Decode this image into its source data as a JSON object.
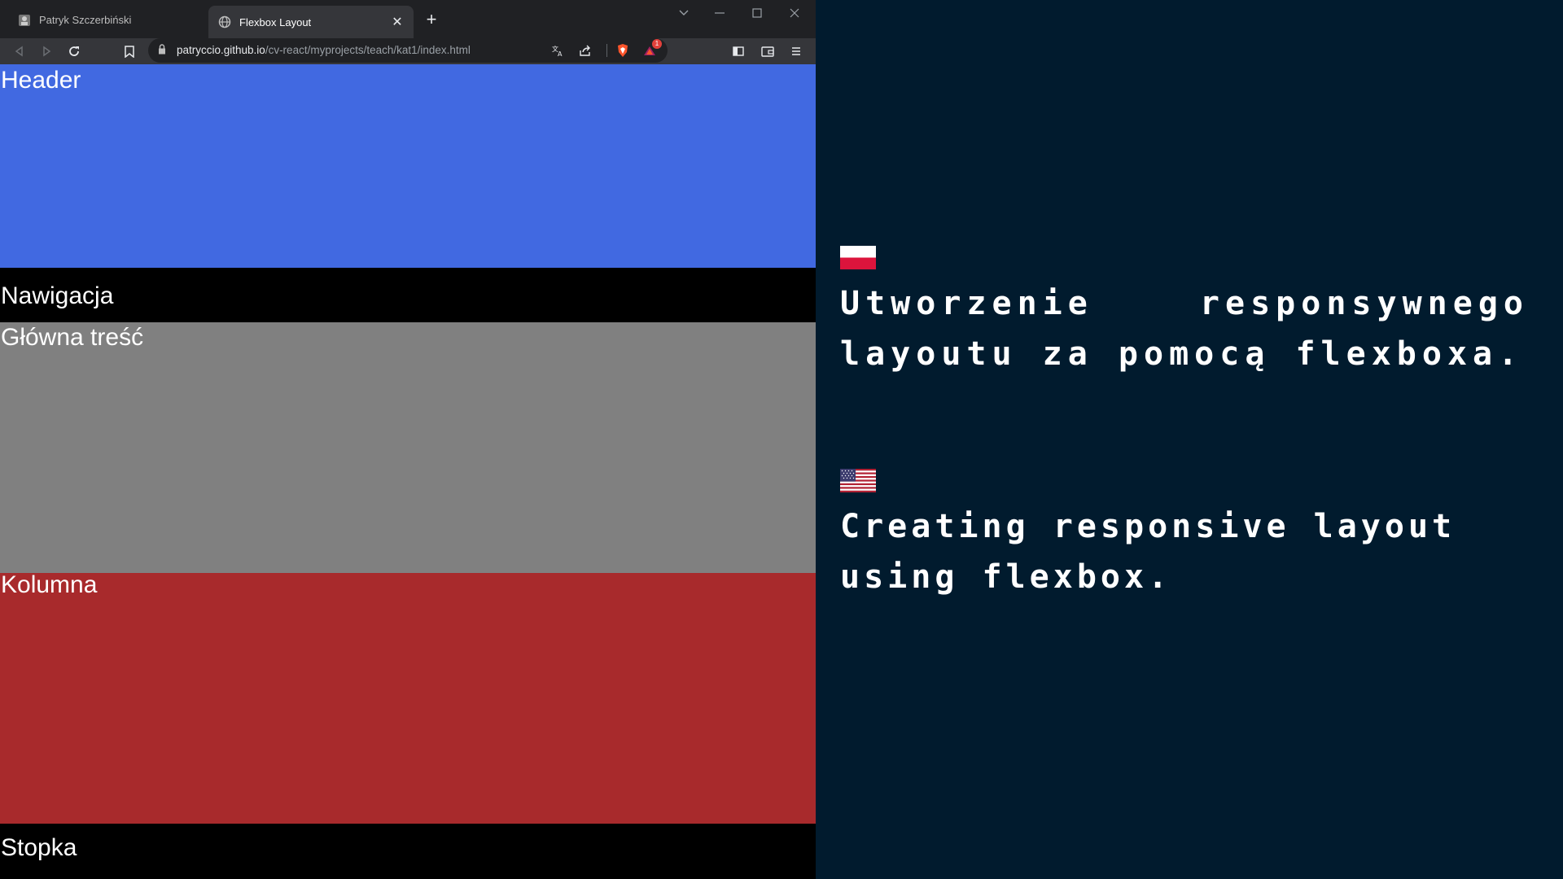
{
  "browser": {
    "tabs": [
      {
        "label": "Patryk Szczerbiński",
        "active": false
      },
      {
        "label": "Flexbox Layout",
        "active": true
      }
    ],
    "url_host": "patryccio.github.io",
    "url_path": "/cv-react/myprojects/teach/kat1/index.html",
    "notification_count": "1",
    "icons": [
      "back-icon",
      "forward-icon",
      "reload-icon",
      "bookmark-icon",
      "lock-icon",
      "translate-icon",
      "share-icon",
      "brave-shield-icon",
      "brave-rewards-icon",
      "sidebar-icon",
      "wallet-icon",
      "menu-icon",
      "minimize-icon",
      "maximize-icon",
      "close-icon",
      "tab-search-icon"
    ]
  },
  "page": {
    "sections": [
      {
        "label": "Header",
        "color": "#4169e1"
      },
      {
        "label": "Nawigacja",
        "color": "#000000"
      },
      {
        "label": "Główna treść",
        "color": "#808080"
      },
      {
        "label": "Kolumna",
        "color": "#a82a2c"
      },
      {
        "label": "Stopka",
        "color": "#000000"
      }
    ]
  },
  "description": {
    "background": "#011b2e",
    "pl_text": "Utworzenie responsywnego layoutu za pomocą flexboxa.",
    "en_text": "Creating responsive layout using flexbox.",
    "flags": [
      "poland-flag",
      "usa-flag"
    ]
  }
}
